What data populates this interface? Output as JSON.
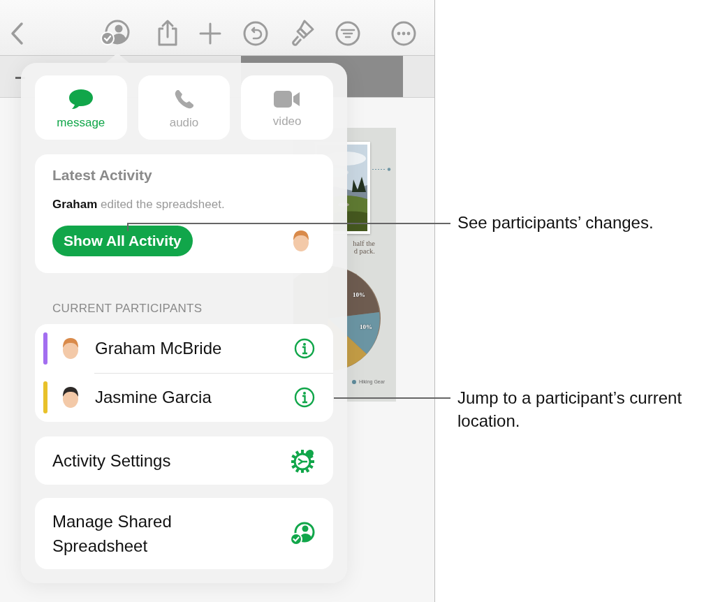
{
  "popover": {
    "contact_buttons": [
      {
        "kind": "message",
        "label": "message",
        "selected": true
      },
      {
        "kind": "audio",
        "label": "audio",
        "selected": false
      },
      {
        "kind": "video",
        "label": "video",
        "selected": false
      }
    ],
    "latest_activity": {
      "title": "Latest Activity",
      "text": "**Graham** edited the spreadsheet.",
      "button": "Show All Activity"
    },
    "participants_header": "CURRENT PARTICIPANTS",
    "participants": [
      {
        "name": "Graham McBride",
        "color": "#a36ef0"
      },
      {
        "name": "Jasmine Garcia",
        "color": "#e8c12a"
      }
    ],
    "actions": [
      {
        "kind": "settings",
        "label": "Activity Settings"
      },
      {
        "kind": "manage",
        "label": "Manage Shared Spreadsheet"
      }
    ]
  },
  "document": {
    "caption_lines": [
      "half the",
      "d pack."
    ],
    "pie_labels": [
      "10%",
      "10%"
    ],
    "legend": "Hiking Gear"
  },
  "callouts": [
    {
      "text": "See participants’ changes."
    },
    {
      "text": "Jump to a participant’s current location."
    }
  ]
}
